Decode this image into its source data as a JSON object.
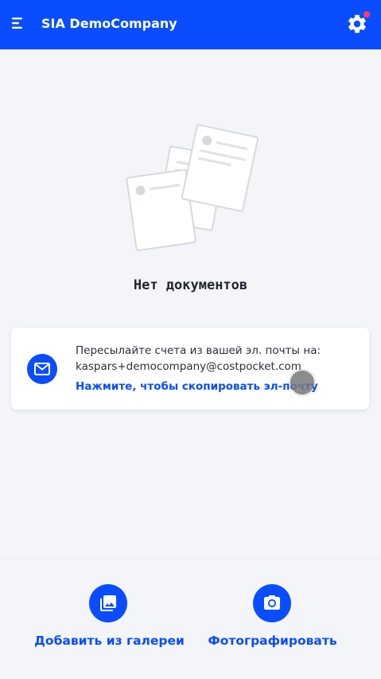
{
  "colors": {
    "accent": "#0a4dff",
    "background": "#f4f5f8",
    "notification": "#ff3b5c",
    "text": "#2b2f36"
  },
  "header": {
    "menu_icon": "menu-icon",
    "title": "SIA DemoCompany",
    "settings_icon": "gear-icon",
    "has_notification": true
  },
  "empty_state": {
    "illustration": "documents-illustration",
    "title": "Нет документов"
  },
  "email_card": {
    "icon": "mail-icon",
    "line1": "Пересылайте счета из вашей эл. почты на:",
    "email": "kaspars+democompany@costpocket.com",
    "copy_link": "Нажмите, чтобы скопировать эл-почту"
  },
  "actions": {
    "gallery": {
      "icon": "gallery-icon",
      "label": "Добавить из галереи"
    },
    "camera": {
      "icon": "camera-icon",
      "label": "Фотографировать"
    }
  }
}
